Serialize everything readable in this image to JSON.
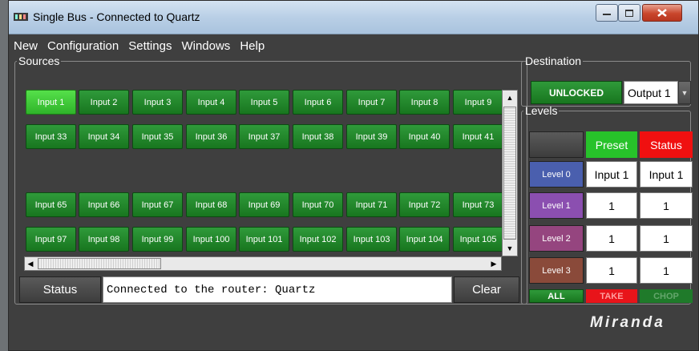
{
  "window": {
    "title": "Single Bus - Connected to Quartz"
  },
  "menu": [
    "New",
    "Configuration",
    "Settings",
    "Windows",
    "Help"
  ],
  "sources": {
    "legend": "Sources",
    "rows": [
      [
        "Input 1",
        "Input 2",
        "Input 3",
        "Input 4",
        "Input 5",
        "Input 6",
        "Input 7",
        "Input 8",
        "Input 9"
      ],
      [
        "Input 33",
        "Input 34",
        "Input 35",
        "Input 36",
        "Input 37",
        "Input 38",
        "Input 39",
        "Input 40",
        "Input 41"
      ],
      [],
      [
        "Input 65",
        "Input 66",
        "Input 67",
        "Input 68",
        "Input 69",
        "Input 70",
        "Input 71",
        "Input 72",
        "Input 73"
      ],
      [
        "Input 97",
        "Input 98",
        "Input 99",
        "Input 100",
        "Input 101",
        "Input 102",
        "Input 103",
        "Input 104",
        "Input 105"
      ]
    ],
    "active": "Input 1"
  },
  "status_bar": {
    "button": "Status",
    "message": "Connected to the router: Quartz",
    "clear": "Clear"
  },
  "destination": {
    "legend": "Destination",
    "lock": "UNLOCKED",
    "output": "Output 1"
  },
  "levels": {
    "legend": "Levels",
    "preset_header": "Preset",
    "status_header": "Status",
    "rows": [
      {
        "label": "Level 0",
        "preset": "Input 1",
        "status": "Input 1",
        "color": "#4a5fae"
      },
      {
        "label": "Level 1",
        "preset": "1",
        "status": "1",
        "color": "#8b4fb0"
      },
      {
        "label": "Level 2",
        "preset": "1",
        "status": "1",
        "color": "#95457f"
      },
      {
        "label": "Level 3",
        "preset": "1",
        "status": "1",
        "color": "#8a4a3a"
      }
    ],
    "all": "ALL",
    "take": "TAKE",
    "chop": "CHOP"
  },
  "logo": "Miranda"
}
